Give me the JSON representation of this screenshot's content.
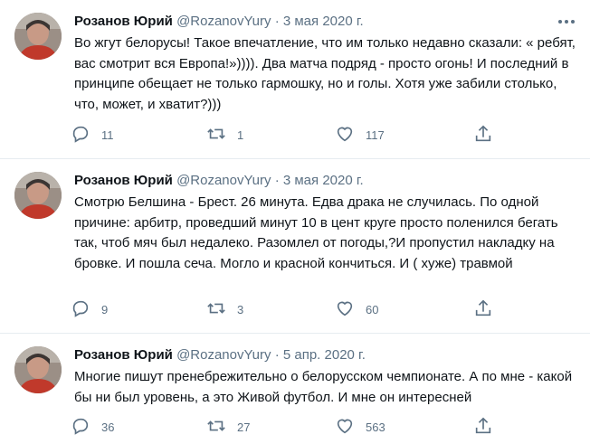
{
  "tweets": [
    {
      "author": "Розанов Юрий",
      "handle": "@RozanovYury",
      "separator": "·",
      "date": "3 мая 2020 г.",
      "text": "Во жгут белорусы! Такое впечатление, что им только недавно сказали: « ребят, вас смотрит вся Европа!»)))). Два матча подряд - просто огонь! И последний в принципе обещает не только гармошку, но и голы. Хотя уже забили столько, что, может, и хватит?)))",
      "replies": "11",
      "retweets": "1",
      "likes": "117"
    },
    {
      "author": "Розанов Юрий",
      "handle": "@RozanovYury",
      "separator": "·",
      "date": "3 мая 2020 г.",
      "text": "Смотрю Белшина - Брест. 26 минута. Едва драка не случилась. По одной причине: арбитр, проведший минут 10 в цент круге просто поленился бегать так, чтоб мяч был недалеко. Разомлел от погоды,?И пропустил накладку на бровке. И пошла сеча. Могло и красной кончиться. И ( хуже) травмой",
      "replies": "9",
      "retweets": "3",
      "likes": "60"
    },
    {
      "author": "Розанов Юрий",
      "handle": "@RozanovYury",
      "separator": "·",
      "date": "5 апр. 2020 г.",
      "text": "Многие пишут пренебрежительно о белорусском чемпионате. А по мне - какой бы ни был уровень, а это Живой футбол. И мне он интересней",
      "replies": "36",
      "retweets": "27",
      "likes": "563"
    }
  ],
  "icons": {
    "more": "more-horizontal-icon",
    "reply": "reply-icon",
    "retweet": "retweet-icon",
    "like": "heart-icon",
    "share": "share-icon"
  },
  "colors": {
    "text": "#0f1419",
    "secondary": "#5b7083",
    "divider": "#e6ecf0"
  }
}
